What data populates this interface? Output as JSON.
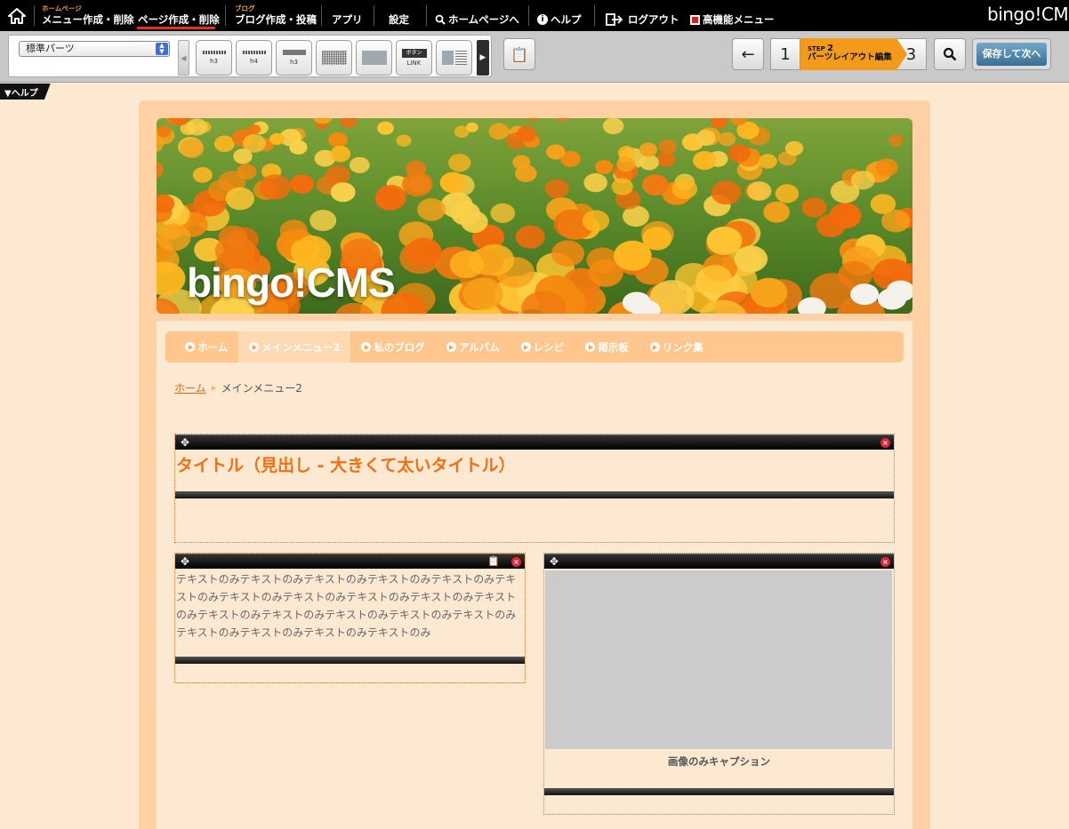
{
  "topbar": {
    "home_icon": "home-icon",
    "items": [
      {
        "sup": "ホームページ",
        "label": "メニュー作成・削除"
      },
      {
        "sup": "",
        "label": "ページ作成・削除"
      },
      {
        "sup": "ブログ",
        "label": "ブログ作成・投稿"
      },
      {
        "sup": "",
        "label": "アプリ"
      },
      {
        "sup": "",
        "label": "設定"
      },
      {
        "sup": "",
        "label": "ホームページへ"
      },
      {
        "sup": "",
        "label": "ヘルプ"
      },
      {
        "sup": "",
        "label": "ログアウト"
      },
      {
        "sup": "",
        "label": "高機能メニュー"
      }
    ],
    "brand": "bingo!CMS",
    "accent": "#e82e1c"
  },
  "toolbar": {
    "select_value": "標準パーツ",
    "parts": [
      {
        "label": "h3"
      },
      {
        "label": "h4"
      },
      {
        "label": "h3"
      },
      {
        "label": ""
      },
      {
        "label": ""
      },
      {
        "label_top": "ボタン",
        "label": "LINK"
      },
      {
        "label": ""
      }
    ],
    "steps": {
      "prev": "1",
      "current_step": "STEP",
      "current_num": "2",
      "current_label": "パーツレイアウト編集",
      "next": "3"
    },
    "save_label": "保存して次へ",
    "step_color": "#f29a1a"
  },
  "help_tab": "▼ヘルプ",
  "site": {
    "hero_title": "bingo!CMS",
    "nav": [
      {
        "label": "ホーム",
        "current": false
      },
      {
        "label": "メインメニュー2",
        "current": true
      },
      {
        "label": "私のブログ",
        "current": false
      },
      {
        "label": "アルバム",
        "current": false
      },
      {
        "label": "レシピ",
        "current": false
      },
      {
        "label": "掲示板",
        "current": false
      },
      {
        "label": "リンク集",
        "current": false
      }
    ],
    "breadcrumb": {
      "home": "ホーム",
      "current": "メインメニュー2"
    },
    "heading_part": "タイトル（見出し - 大きくて太いタイトル）",
    "text_part": "テキストのみテキストのみテキストのみテキストのみテキストのみテキストのみテキストのみテキストのみテキストのみテキストのみテキストのみテキストのみテキストのみテキストのみテキストのみテキストのみテキストのみテキストのみテキストのみテキストのみ",
    "image_caption": "画像のみキャプション",
    "heading_color": "#f36f12"
  }
}
